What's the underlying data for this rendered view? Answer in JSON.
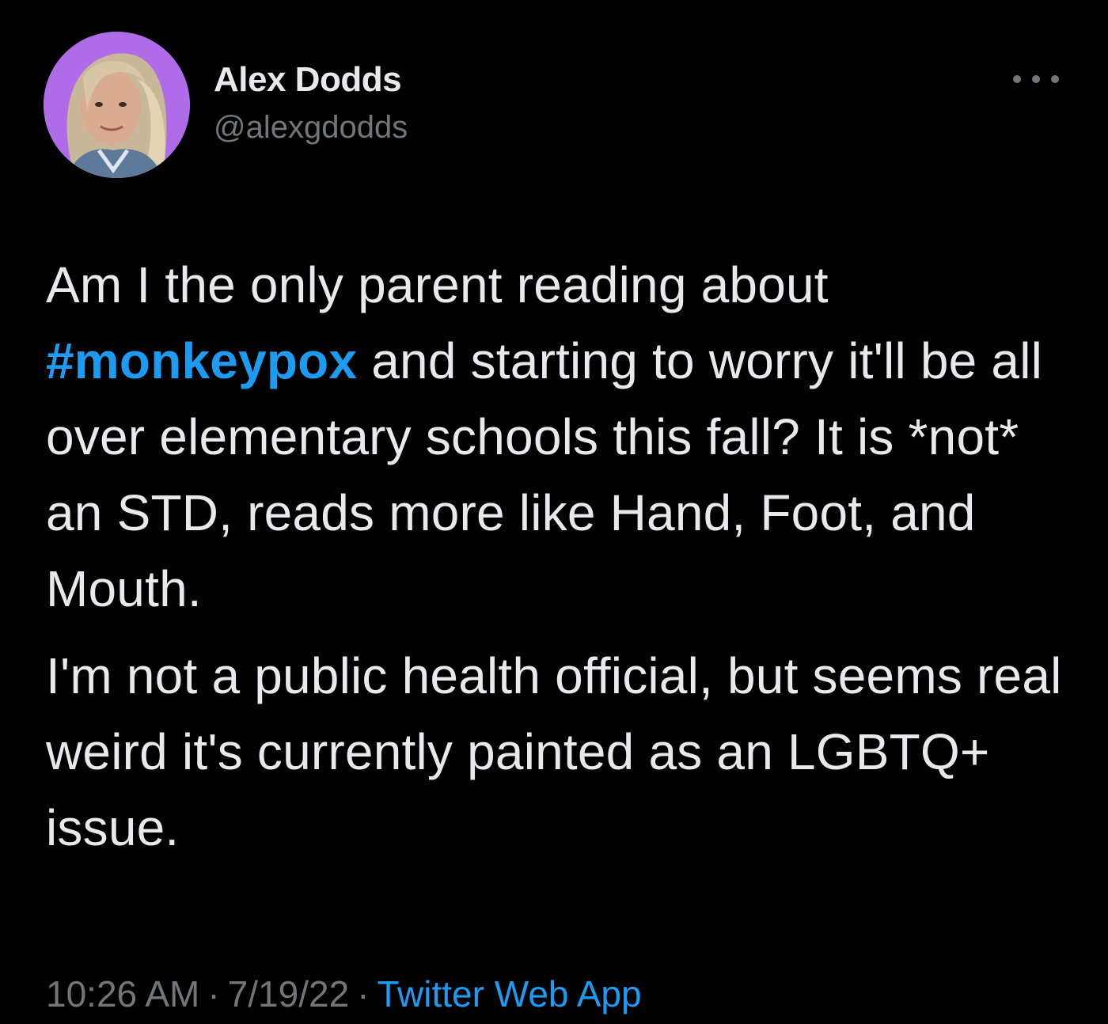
{
  "author": {
    "display_name": "Alex Dodds",
    "handle": "@alexgdodds"
  },
  "more_button_icon": "more-horizontal-icon",
  "tweet": {
    "paragraph_1": {
      "line_1": "Am I the only parent reading about",
      "hashtag": "#monkeypox",
      "rest": " and starting to worry it'll be all over elementary schools this fall? It is *not* an STD, reads more like Hand, Foot, and Mouth."
    },
    "paragraph_2": "I'm not a public health official, but seems real weird it's currently painted as an LGBTQ+ issue."
  },
  "meta": {
    "time": "10:26 AM",
    "separator": "·",
    "date": "7/19/22",
    "source": "Twitter Web App"
  },
  "colors": {
    "background": "#000000",
    "text": "#e7e9ea",
    "secondary": "#71767b",
    "accent": "#1d9bf0",
    "avatar_bg": "#b06ce8"
  }
}
